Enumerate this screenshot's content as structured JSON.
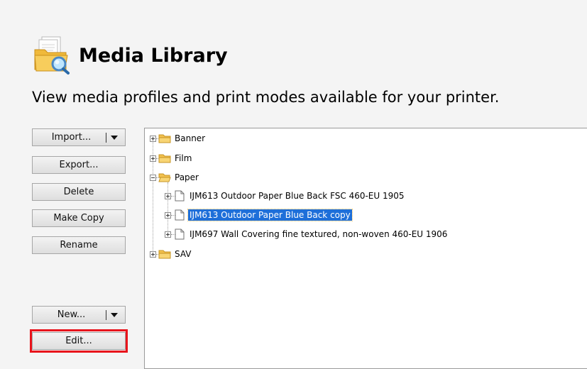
{
  "header": {
    "title": "Media Library",
    "icon": "media-library-folder-magnifier-icon"
  },
  "subtitle": "View media profiles and print modes available for your printer.",
  "buttons": {
    "import": "Import...",
    "export": "Export...",
    "delete": "Delete",
    "make_copy": "Make Copy",
    "rename": "Rename",
    "new": "New...",
    "edit": "Edit..."
  },
  "highlight_color": "#e8141c",
  "selection_color": "#1e6fd9",
  "tree": {
    "folders": [
      {
        "label": "Banner",
        "expanded": false
      },
      {
        "label": "Film",
        "expanded": false
      },
      {
        "label": "Paper",
        "expanded": true,
        "children": [
          {
            "label": "IJM613 Outdoor Paper Blue Back  FSC 460-EU 1905",
            "selected": false
          },
          {
            "label": "IJM613 Outdoor Paper Blue Back copy",
            "selected": true
          },
          {
            "label": "IJM697 Wall Covering fine textured, non-woven 460-EU 1906",
            "selected": false
          }
        ]
      },
      {
        "label": "SAV",
        "expanded": false
      }
    ]
  }
}
